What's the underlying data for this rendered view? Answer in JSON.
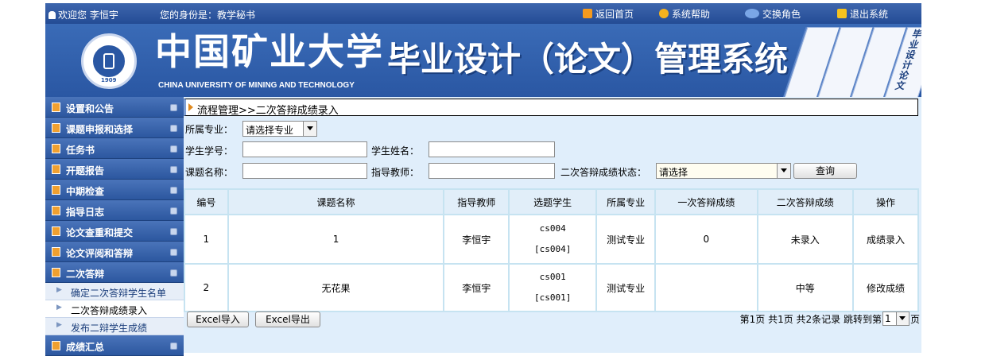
{
  "topbar": {
    "welcome": "欢迎您 李恒宇",
    "identity": "您的身份是：教学秘书",
    "links": [
      {
        "label": "返回首页",
        "icon": "home-icon",
        "color": "#f59a1e"
      },
      {
        "label": "系统帮助",
        "icon": "help-icon",
        "color": "#f5b21e"
      },
      {
        "label": "交换角色",
        "icon": "users-icon",
        "color": "#7aa6e6"
      },
      {
        "label": "退出系统",
        "icon": "exit-icon",
        "color": "#f5c21e"
      }
    ]
  },
  "banner": {
    "university_cn": "中国矿业大学",
    "university_en": "CHINA UNIVERSITY OF MINING AND TECHNOLOGY",
    "system_title": "毕业设计（论文）管理系统",
    "emblem_year": "1909",
    "book_text": "毕业设计论文"
  },
  "sidebar": {
    "items": [
      {
        "label": "设置和公告"
      },
      {
        "label": "课题申报和选择"
      },
      {
        "label": "任务书"
      },
      {
        "label": "开题报告"
      },
      {
        "label": "中期检查"
      },
      {
        "label": "指导日志"
      },
      {
        "label": "论文查重和提交"
      },
      {
        "label": "论文评阅和答辩"
      },
      {
        "label": "二次答辩"
      }
    ],
    "sub_items": [
      {
        "label": "确定二次答辩学生名单"
      },
      {
        "label": "二次答辩成绩录入"
      },
      {
        "label": "发布二辩学生成绩"
      }
    ],
    "last_item": "成绩汇总"
  },
  "breadcrumb": "流程管理>>二次答辩成绩录入",
  "filters": {
    "major_label": "所属专业：",
    "major_value": "请选择专业",
    "student_id_label": "学生学号：",
    "student_id_value": "",
    "student_name_label": "学生姓名：",
    "student_name_value": "",
    "topic_label": "课题名称：",
    "topic_value": "",
    "teacher_label": "指导教师：",
    "teacher_value": "",
    "status_label": "二次答辩成绩状态：",
    "status_value": "请选择",
    "query_button": "查询"
  },
  "table": {
    "headers": [
      "编号",
      "课题名称",
      "指导教师",
      "选题学生",
      "所属专业",
      "一次答辩成绩",
      "二次答辩成绩",
      "操作"
    ],
    "rows": [
      {
        "no": "1",
        "topic": "1",
        "teacher": "李恒宇",
        "student": "cs004",
        "student_id": "[cs004]",
        "major": "测试专业",
        "first_score": "0",
        "second_score": "未录入",
        "action": "成绩录入"
      },
      {
        "no": "2",
        "topic": "无花果",
        "teacher": "李恒宇",
        "student": "cs001",
        "student_id": "[cs001]",
        "major": "测试专业",
        "first_score": "",
        "second_score": "中等",
        "action": "修改成绩"
      }
    ]
  },
  "footer": {
    "import_button": "Excel导入",
    "export_button": "Excel导出",
    "pager_info": "第1页 共1页 共2条记录 跳转到第",
    "page_value": "1",
    "pager_suffix": "页"
  }
}
